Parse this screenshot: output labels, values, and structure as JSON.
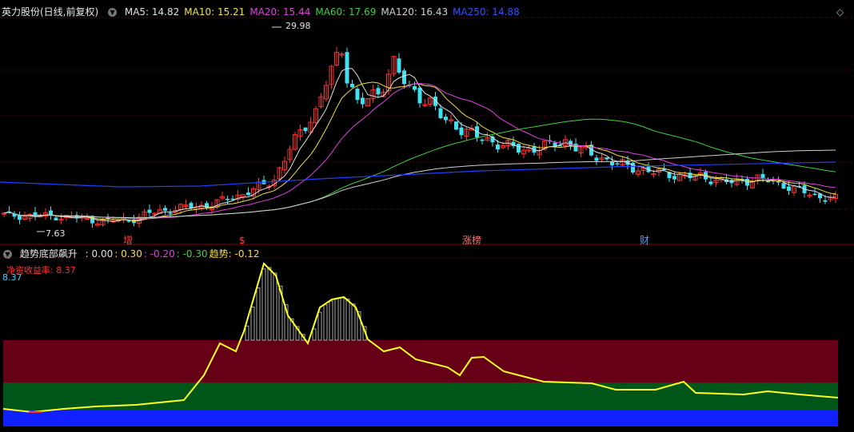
{
  "main": {
    "title": "英力股份(日线,前复权)",
    "ma": [
      {
        "label": "MA5: 14.82",
        "color": "#e0e0e0"
      },
      {
        "label": "MA10: 15.21",
        "color": "#f0e040"
      },
      {
        "label": "MA20: 15.44",
        "color": "#e040e0"
      },
      {
        "label": "MA60: 17.69",
        "color": "#40d040"
      },
      {
        "label": "MA120: 16.43",
        "color": "#d0d0d0"
      },
      {
        "label": "MA250: 14.88",
        "color": "#3050ff"
      }
    ],
    "high_label": "29.98",
    "low_label": "7.63",
    "tags": [
      {
        "text": "增",
        "color": "#ff4040"
      },
      {
        "text": "$",
        "color": "#ff4040"
      },
      {
        "text": "涨榜",
        "color": "#ff7070"
      },
      {
        "text": "财",
        "color": "#4aa0ff"
      }
    ]
  },
  "indicator": {
    "title": "趋势底部飙升",
    "params": [
      {
        "label": ": 0.00",
        "color": "#e0e0e0"
      },
      {
        "label": ": 0.30",
        "color": "#f0e040"
      },
      {
        "label": ": -0.20",
        "color": "#e040e0"
      },
      {
        "label": ": -0.30",
        "color": "#40d040"
      },
      {
        "label": "趋势: -0.12",
        "color": "#f0e040"
      }
    ],
    "profit_label": "净资收益率: 8.37",
    "value_label": "8.37"
  },
  "chart_data": [
    {
      "type": "candlestick",
      "title": "英力股份(日线,前复权)",
      "annotations": {
        "high": 29.98,
        "low": 7.63
      },
      "series": [
        {
          "name": "MA5",
          "last": 14.82
        },
        {
          "name": "MA10",
          "last": 15.21
        },
        {
          "name": "MA20",
          "last": 15.44
        },
        {
          "name": "MA60",
          "last": 17.69
        },
        {
          "name": "MA120",
          "last": 16.43
        },
        {
          "name": "MA250",
          "last": 14.88
        }
      ]
    },
    {
      "type": "area",
      "title": "趋势底部飙升",
      "series": [
        {
          "name": "趋势",
          "last": -0.12
        }
      ]
    }
  ]
}
